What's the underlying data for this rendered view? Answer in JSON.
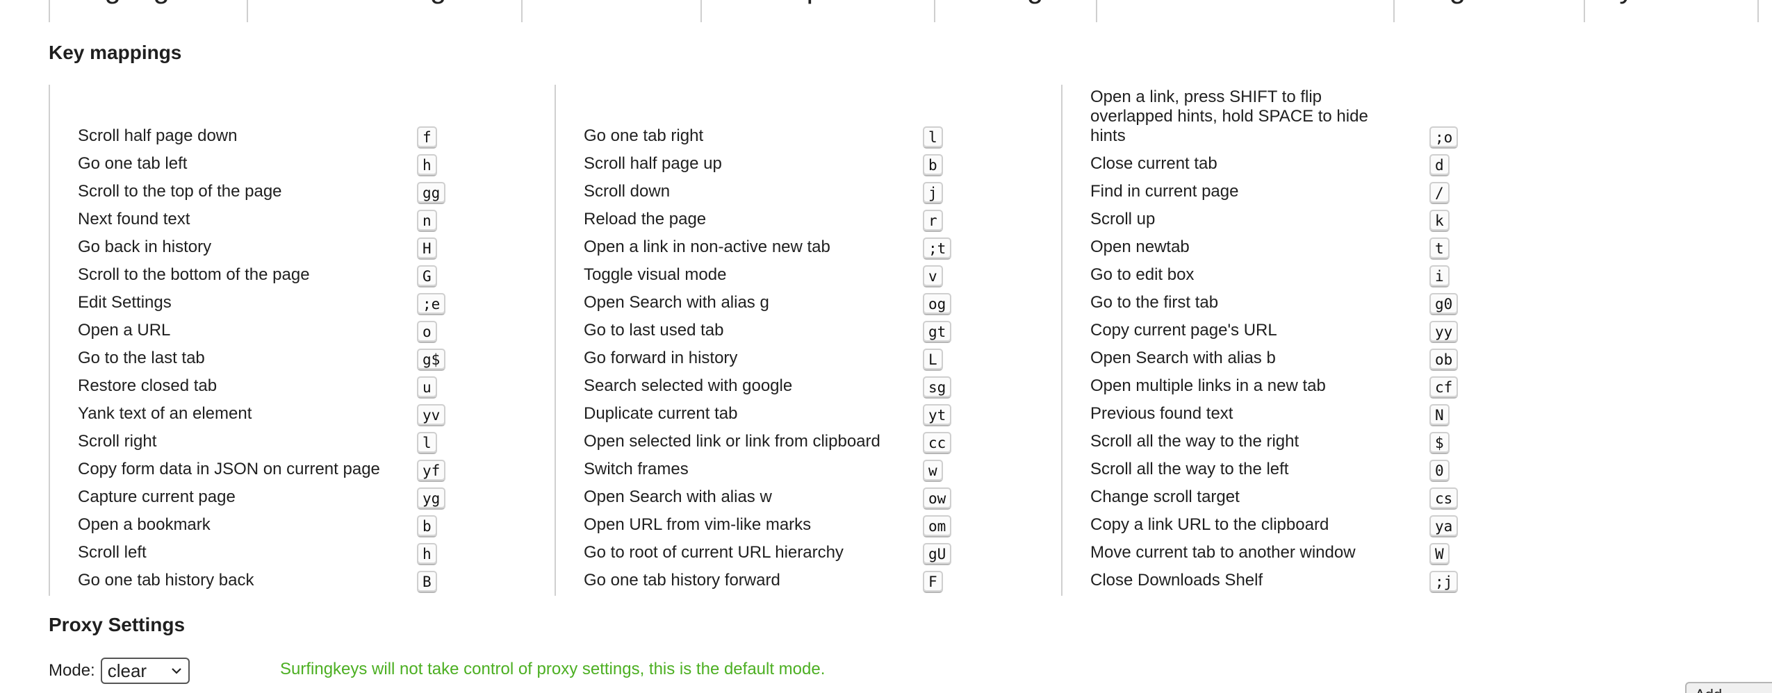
{
  "search_aliases": [
    "google",
    "duckduckgo",
    "baidu",
    "wikipedia",
    "bing",
    "stackoverflow",
    "github",
    "youtube"
  ],
  "key_mappings": {
    "title": "Key mappings",
    "columns": [
      [
        {
          "label": "Scroll half page down",
          "key": "f"
        },
        {
          "label": "Go one tab left",
          "key": "h"
        },
        {
          "label": "Scroll to the top of the page",
          "key": "gg"
        },
        {
          "label": "Next found text",
          "key": "n"
        },
        {
          "label": "Go back in history",
          "key": "H"
        },
        {
          "label": "Scroll to the bottom of the page",
          "key": "G"
        },
        {
          "label": "Edit Settings",
          "key": ";e"
        },
        {
          "label": "Open a URL",
          "key": "o"
        },
        {
          "label": "Go to the last tab",
          "key": "g$"
        },
        {
          "label": "Restore closed tab",
          "key": "u"
        },
        {
          "label": "Yank text of an element",
          "key": "yv"
        },
        {
          "label": "Scroll right",
          "key": "l"
        },
        {
          "label": "Copy form data in JSON on current page",
          "key": "yf"
        },
        {
          "label": "Capture current page",
          "key": "yg"
        },
        {
          "label": "Open a bookmark",
          "key": "b"
        },
        {
          "label": "Scroll left",
          "key": "h"
        },
        {
          "label": "Go one tab history back",
          "key": "B"
        }
      ],
      [
        {
          "label": "Go one tab right",
          "key": "l"
        },
        {
          "label": "Scroll half page up",
          "key": "b"
        },
        {
          "label": "Scroll down",
          "key": "j"
        },
        {
          "label": "Reload the page",
          "key": "r"
        },
        {
          "label": "Open a link in non-active new tab",
          "key": ";t"
        },
        {
          "label": "Toggle visual mode",
          "key": "v"
        },
        {
          "label": "Open Search with alias g",
          "key": "og"
        },
        {
          "label": "Go to last used tab",
          "key": "gt"
        },
        {
          "label": "Go forward in history",
          "key": "L"
        },
        {
          "label": "Search selected with google",
          "key": "sg"
        },
        {
          "label": "Duplicate current tab",
          "key": "yt"
        },
        {
          "label": "Open selected link or link from clipboard",
          "key": "cc"
        },
        {
          "label": "Switch frames",
          "key": "w"
        },
        {
          "label": "Open Search with alias w",
          "key": "ow"
        },
        {
          "label": "Open URL from vim-like marks",
          "key": "om"
        },
        {
          "label": "Go to root of current URL hierarchy",
          "key": "gU"
        },
        {
          "label": "Go one tab history forward",
          "key": "F"
        }
      ],
      [
        {
          "label": "Open a link, press SHIFT to flip overlapped hints, hold SPACE to hide hints",
          "key": ";o"
        },
        {
          "label": "Close current tab",
          "key": "d"
        },
        {
          "label": "Find in current page",
          "key": "/"
        },
        {
          "label": "Scroll up",
          "key": "k"
        },
        {
          "label": "Open newtab",
          "key": "t"
        },
        {
          "label": "Go to edit box",
          "key": "i"
        },
        {
          "label": "Go to the first tab",
          "key": "g0"
        },
        {
          "label": "Copy current page's URL",
          "key": "yy"
        },
        {
          "label": "Open Search with alias b",
          "key": "ob"
        },
        {
          "label": "Open multiple links in a new tab",
          "key": "cf"
        },
        {
          "label": "Previous found text",
          "key": "N"
        },
        {
          "label": "Scroll all the way to the right",
          "key": "$"
        },
        {
          "label": "Scroll all the way to the left",
          "key": "0"
        },
        {
          "label": "Change scroll target",
          "key": "cs"
        },
        {
          "label": "Copy a link URL to the clipboard",
          "key": "ya"
        },
        {
          "label": "Move current tab to another window",
          "key": "W"
        },
        {
          "label": "Close Downloads Shelf",
          "key": ";j"
        }
      ]
    ]
  },
  "proxy_settings": {
    "title": "Proxy Settings",
    "mode_label": "Mode:",
    "mode_value": "clear",
    "note": "Surfingkeys will not take control of proxy settings, this is the default mode.",
    "note_color": "#4caf22"
  },
  "corner_button": {
    "label": "Add"
  }
}
